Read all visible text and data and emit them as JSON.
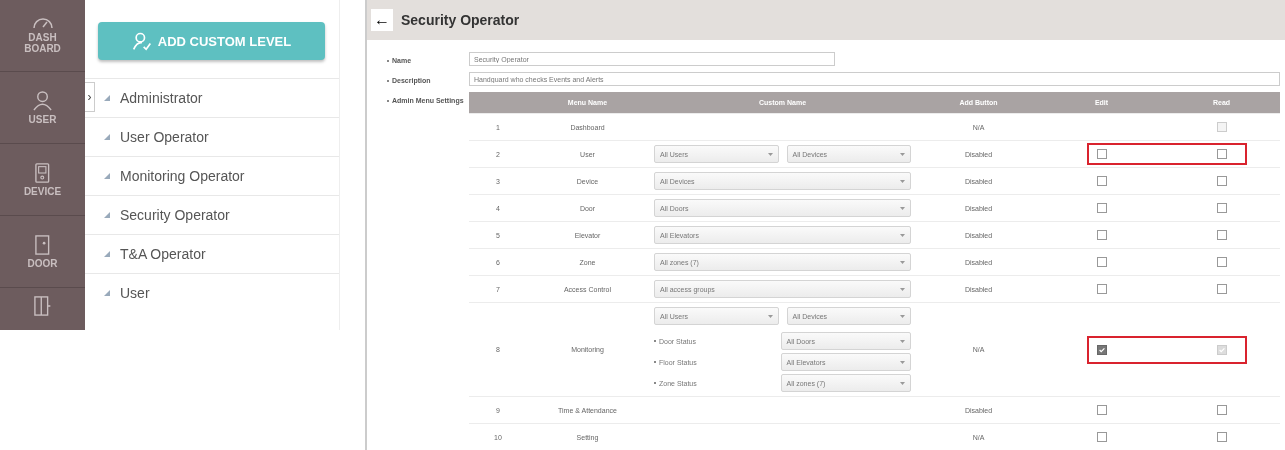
{
  "nav": [
    {
      "label": "DASH BOARD"
    },
    {
      "label": "USER"
    },
    {
      "label": "DEVICE"
    },
    {
      "label": "DOOR"
    }
  ],
  "add_button": "ADD CUSTOM LEVEL",
  "levels": [
    {
      "label": "Administrator",
      "toggle": "›"
    },
    {
      "label": "User Operator"
    },
    {
      "label": "Monitoring Operator"
    },
    {
      "label": "Security Operator"
    },
    {
      "label": "T&A Operator"
    },
    {
      "label": "User"
    }
  ],
  "page": {
    "back": "←",
    "title": "Security Operator"
  },
  "form": {
    "name_label": "Name",
    "name_value": "Security Operator",
    "description_label": "Description",
    "description_value": "Handguard who checks Events and Alerts",
    "menu_label": "Admin Menu Settings"
  },
  "table": {
    "columns": [
      "Menu Name",
      "Custom Name",
      "Add Button",
      "Edit",
      "Read"
    ],
    "rows": [
      {
        "number": "1",
        "menu": "Dashboard",
        "selects": [],
        "add": "N/A",
        "read": {
          "checked": false,
          "disabled": true
        },
        "highlighted": false
      },
      {
        "number": "2",
        "menu": "User",
        "selects": [
          "All Users",
          "All Devices"
        ],
        "add": "Disabled",
        "edit": {
          "checked": false,
          "disabled": false
        },
        "read": {
          "checked": false,
          "disabled": false
        },
        "highlighted": true
      },
      {
        "number": "3",
        "menu": "Device",
        "selects": [
          "All Devices"
        ],
        "add": "Disabled",
        "edit": {
          "checked": false,
          "disabled": false
        },
        "read": {
          "checked": false,
          "disabled": false
        },
        "highlighted": false
      },
      {
        "number": "4",
        "menu": "Door",
        "selects": [
          "All Doors"
        ],
        "add": "Disabled",
        "edit": {
          "checked": false,
          "disabled": false
        },
        "read": {
          "checked": false,
          "disabled": false
        },
        "highlighted": false
      },
      {
        "number": "5",
        "menu": "Elevator",
        "selects": [
          "All Elevators"
        ],
        "add": "Disabled",
        "edit": {
          "checked": false,
          "disabled": false
        },
        "read": {
          "checked": false,
          "disabled": false
        },
        "highlighted": false
      },
      {
        "number": "6",
        "menu": "Zone",
        "selects": [
          "All zones (7)"
        ],
        "add": "Disabled",
        "edit": {
          "checked": false,
          "disabled": false
        },
        "read": {
          "checked": false,
          "disabled": false
        },
        "highlighted": false
      },
      {
        "number": "7",
        "menu": "Access Control",
        "selects": [
          "All access groups"
        ],
        "add": "Disabled",
        "edit": {
          "checked": false,
          "disabled": false
        },
        "read": {
          "checked": false,
          "disabled": false
        },
        "highlighted": false
      },
      {
        "number": "8",
        "menu": "Monitoring",
        "selects": [
          "All Users",
          "All Devices"
        ],
        "statuses": [
          {
            "label": "Door Status",
            "value": "All Doors"
          },
          {
            "label": "Floor Status",
            "value": "All Elevators"
          },
          {
            "label": "Zone Status",
            "value": "All zones (7)"
          }
        ],
        "add": "N/A",
        "edit": {
          "checked": true,
          "disabled": false
        },
        "read": {
          "checked": true,
          "disabled": true
        },
        "highlighted": true
      },
      {
        "number": "9",
        "menu": "Time & Attendance",
        "selects": [],
        "add": "Disabled",
        "edit": {
          "checked": false,
          "disabled": false
        },
        "read": {
          "checked": false,
          "disabled": false
        },
        "highlighted": false
      },
      {
        "number": "10",
        "menu": "Setting",
        "selects": [],
        "add": "N/A",
        "edit": {
          "checked": false,
          "disabled": false
        },
        "read": {
          "checked": false,
          "disabled": false
        },
        "highlighted": false
      }
    ]
  }
}
